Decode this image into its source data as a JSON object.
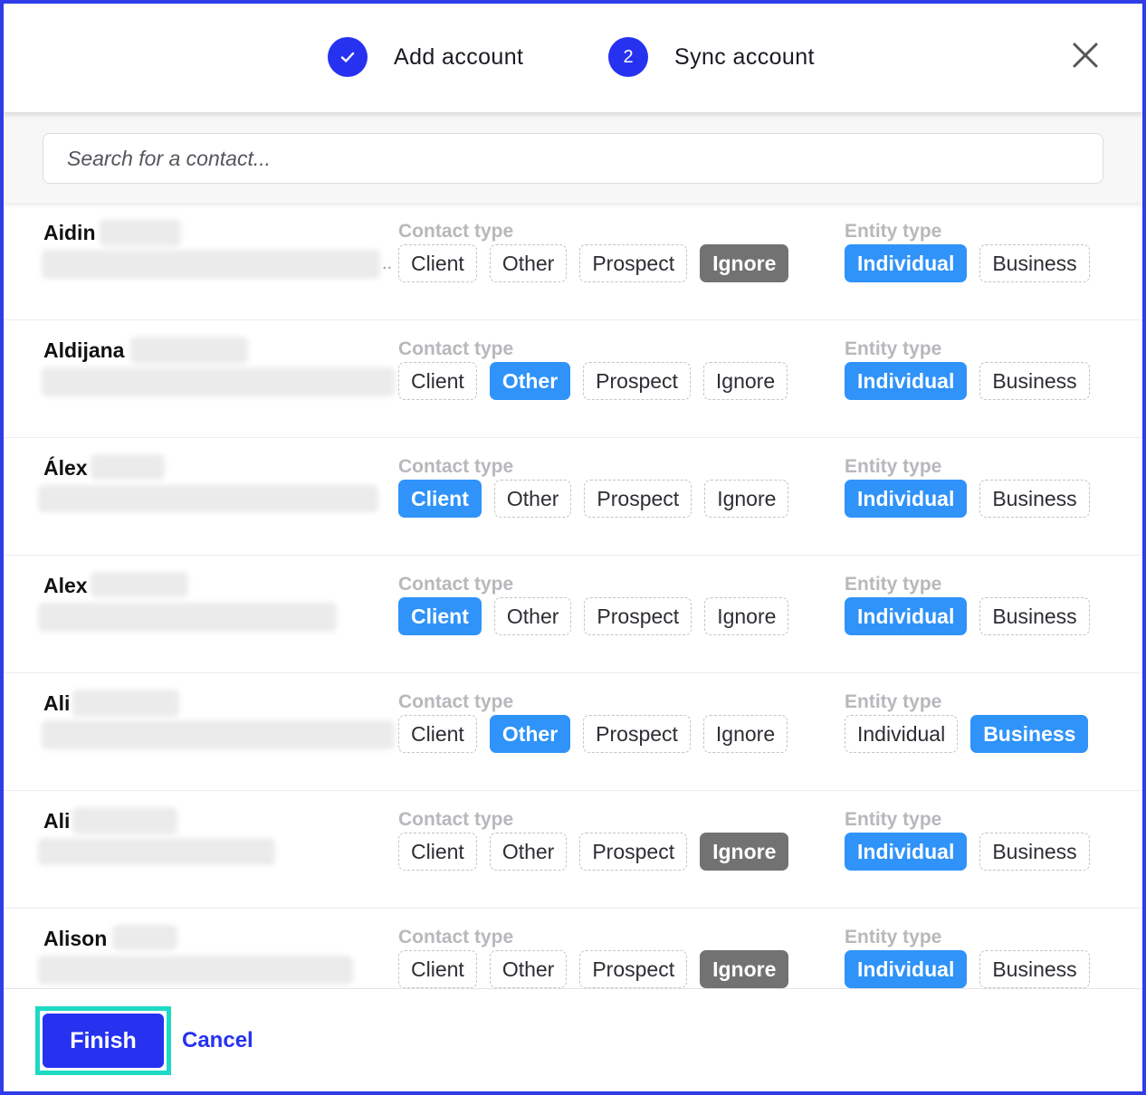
{
  "header": {
    "steps": [
      {
        "label": "Add account",
        "icon": "check-icon",
        "state": "completed"
      },
      {
        "label": "Sync account",
        "number": "2",
        "state": "active"
      }
    ],
    "close_icon": "close-icon"
  },
  "search": {
    "placeholder": "Search for a contact..."
  },
  "labels": {
    "contact_type": "Contact type",
    "entity_type": "Entity type"
  },
  "contact_type_options": [
    "Client",
    "Other",
    "Prospect",
    "Ignore"
  ],
  "entity_type_options": [
    "Individual",
    "Business"
  ],
  "contacts": [
    {
      "name": "Aidin",
      "contact_type": "Ignore",
      "entity_type": "Individual",
      "detail_ellipsis": ".."
    },
    {
      "name": "Aldijana",
      "contact_type": "Other",
      "entity_type": "Individual"
    },
    {
      "name": "Álex",
      "contact_type": "Client",
      "entity_type": "Individual"
    },
    {
      "name": "Alex",
      "contact_type": "Client",
      "entity_type": "Individual"
    },
    {
      "name": "Ali",
      "contact_type": "Other",
      "entity_type": "Business"
    },
    {
      "name": "Ali",
      "contact_type": "Ignore",
      "entity_type": "Individual"
    },
    {
      "name": "Alison",
      "contact_type": "Ignore",
      "entity_type": "Individual"
    }
  ],
  "footer": {
    "finish_label": "Finish",
    "cancel_label": "Cancel"
  },
  "colors": {
    "primary": "#2632f0",
    "selected_blue": "#2f93f9",
    "selected_gray": "#727272",
    "highlight": "#1ed9c3",
    "frame": "#2f3ce8"
  }
}
